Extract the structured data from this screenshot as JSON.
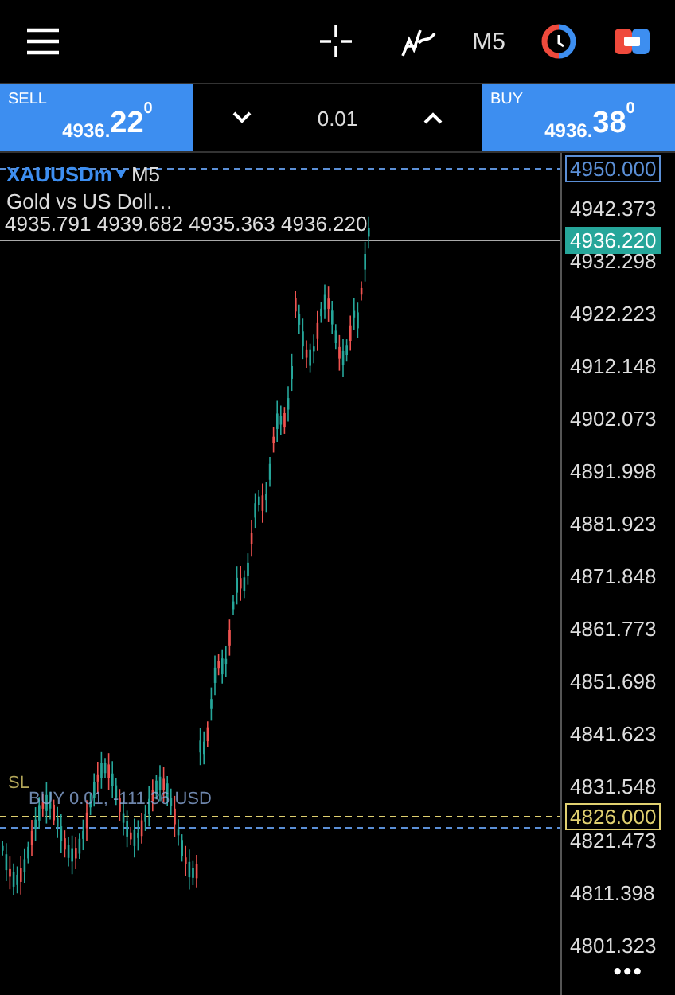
{
  "toolbar": {
    "timeframe": "M5"
  },
  "trade_panel": {
    "sell": {
      "label": "SELL",
      "price": "4936.",
      "price_big": "22",
      "price_sup": "0"
    },
    "volume": "0.01",
    "buy": {
      "label": "BUY",
      "price": "4936.",
      "price_big": "38",
      "price_sup": "0"
    }
  },
  "chart": {
    "symbol": "XAUUSDm",
    "timeframe": "M5",
    "description": "Gold vs US Doll…",
    "ohlc": "4935.791 4939.682 4935.363 4936.220",
    "price_scale": [
      "4942.373",
      "4932.298",
      "4922.223",
      "4912.148",
      "4902.073",
      "4891.998",
      "4881.923",
      "4871.848",
      "4861.773",
      "4851.698",
      "4841.623",
      "4831.548",
      "4821.473",
      "4811.398",
      "4801.323"
    ],
    "ask_price": "4950.000",
    "bid_price": "4936.220",
    "order": {
      "price": "4826.000",
      "label": "BUY 0.01, -111.36 USD",
      "sl_label": "SL"
    },
    "menu": "•••"
  }
}
